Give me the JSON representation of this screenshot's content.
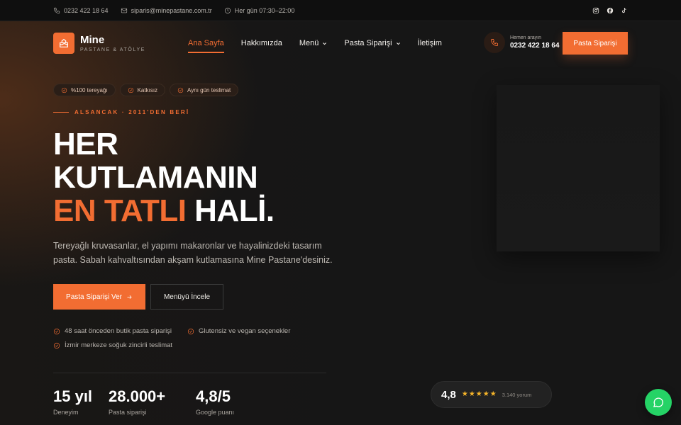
{
  "topbar": {
    "phone": "0232 422 18 64",
    "email": "siparis@minepastane.com.tr",
    "hours": "Her gün 07:30–22:00",
    "social": [
      "instagram-icon",
      "facebook-icon",
      "tiktok-icon"
    ]
  },
  "brand": {
    "name": "Mine",
    "tagline": "PASTANE & ATÖLYE",
    "accent": "#f26d32"
  },
  "nav": {
    "items": [
      {
        "label": "Ana Sayfa",
        "active": true
      },
      {
        "label": "Hakkımızda"
      },
      {
        "label": "Menü",
        "dropdown": true
      },
      {
        "label": "Pasta Siparişi",
        "dropdown": true
      },
      {
        "label": "İletişim"
      }
    ]
  },
  "call": {
    "label": "Hemen arayın",
    "number": "0232 422 18 64"
  },
  "header_cta": "Pasta Siparişi",
  "badges": [
    "%100 tereyağı",
    "Katkısız",
    "Aynı gün teslimat"
  ],
  "eyebrow": "ALSANCAK · 2011'DEN BERİ",
  "headline": {
    "line1": "HER",
    "line2": "KUTLAMANIN",
    "line3_highlight": "EN TATLI",
    "line3_rest": " HALİ."
  },
  "lede": "Tereyağlı kruvasanlar, el yapımı makaronlar ve hayalinizdeki tasarım pasta. Sabah kahvaltısından akşam kutlamasına Mine Pastane'desiniz.",
  "buttons": {
    "primary": "Pasta Siparişi Ver",
    "secondary": "Menüyü İncele"
  },
  "features": [
    "48 saat önceden butik pasta siparişi",
    "Glutensiz ve vegan seçenekler",
    "İzmir merkeze soğuk zincirli teslimat"
  ],
  "stats": [
    {
      "value": "15 yıl",
      "label": "Deneyim"
    },
    {
      "value": "28.000+",
      "label": "Pasta siparişi"
    },
    {
      "value": "4,8/5",
      "label": "Google puanı"
    }
  ],
  "rating": {
    "value": "4,8",
    "stars": 5,
    "count": "3.140 yorum"
  },
  "whatsapp": "whatsapp-icon"
}
